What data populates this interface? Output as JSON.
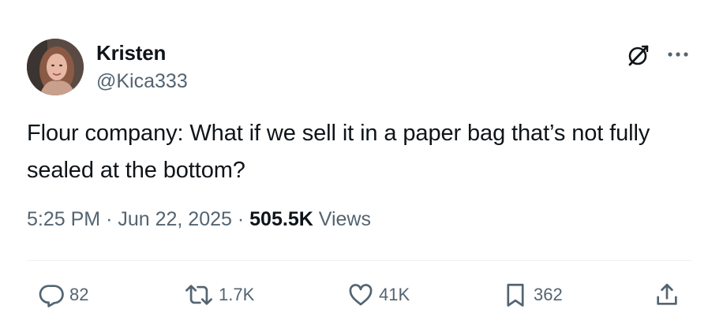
{
  "author": {
    "name": "Kristen",
    "handle": "@Kica333"
  },
  "tweet": {
    "text": "Flour company: What if we sell it in a paper bag that’s not fully sealed at the bottom?"
  },
  "meta": {
    "time": "5:25 PM",
    "separator": "·",
    "date": "Jun 22, 2025",
    "views_count": "505.5K",
    "views_label": "Views"
  },
  "actions": {
    "replies": "82",
    "reposts": "1.7K",
    "likes": "41K",
    "bookmarks": "362"
  },
  "icons": {
    "grok": "grok-icon",
    "more": "more-icon",
    "reply": "reply-icon",
    "repost": "repost-icon",
    "like": "heart-icon",
    "bookmark": "bookmark-icon",
    "share": "share-icon"
  },
  "colors": {
    "text_primary": "#0f1419",
    "text_secondary": "#536471",
    "divider": "#eff3f4"
  }
}
